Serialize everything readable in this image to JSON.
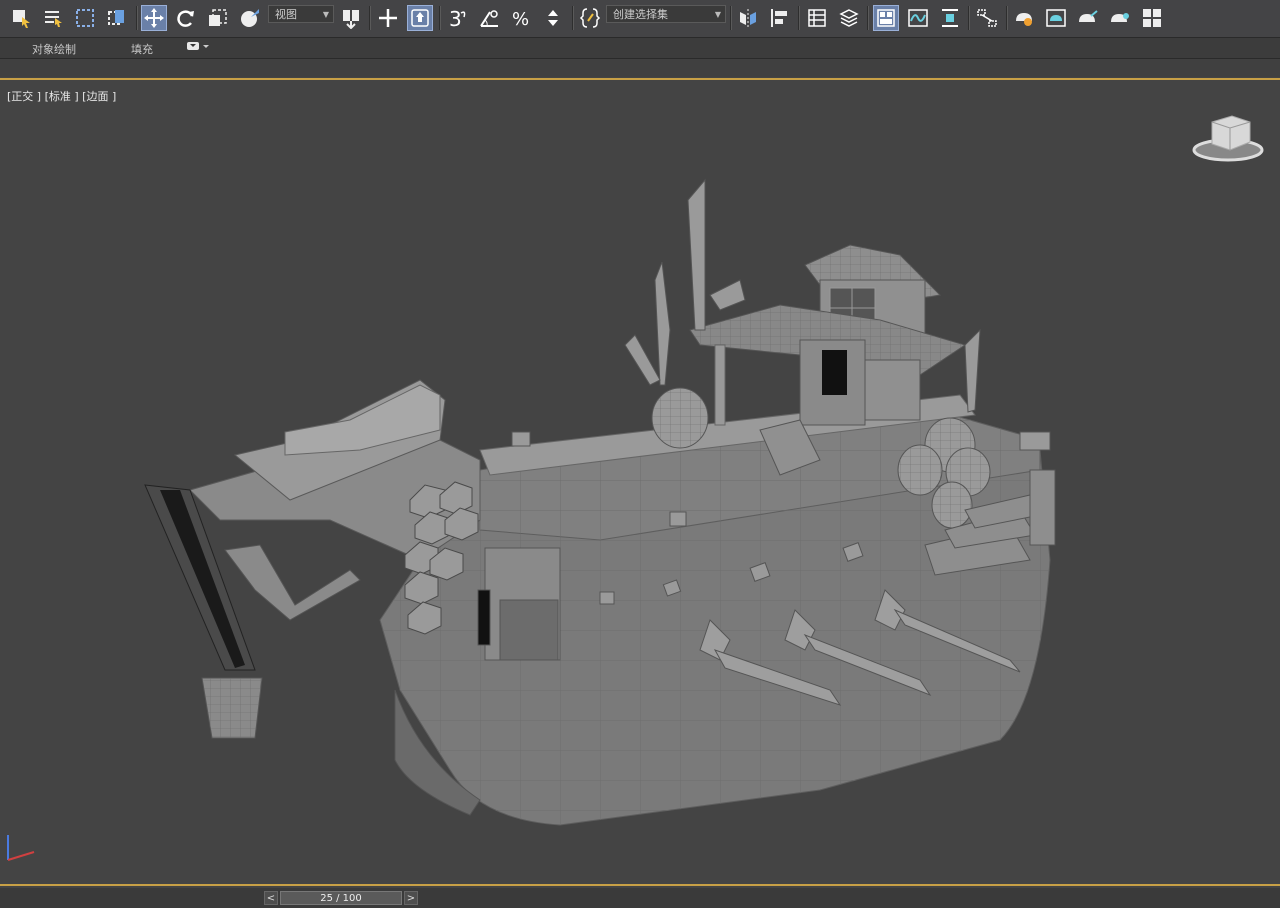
{
  "toolbar": {
    "view_dropdown": "视图",
    "selection_set_dropdown": "创建选择集",
    "snap_label": "3",
    "percent_snap_label": "%"
  },
  "ribbon": {
    "tabs": [
      "对象绘制",
      "填充"
    ]
  },
  "viewport": {
    "label": "[正交 ] [标准 ] [边面 ]",
    "border_color": "#c8a046",
    "background": "#444444"
  },
  "time_slider": {
    "prev_label": "<",
    "frame": "25 / 100",
    "next_label": ">"
  },
  "icons": [
    "select-object-icon",
    "select-by-name-icon",
    "region-select-icon",
    "window-crossing-icon",
    "move-icon",
    "rotate-icon",
    "scale-icon",
    "placement-icon",
    "mirror-dropdown-icon",
    "pivot-icon",
    "keyboard-shortcut-icon",
    "snap-3d-icon",
    "angle-snap-icon",
    "percent-snap-icon",
    "spinner-snap-icon",
    "edit-named-sets-icon",
    "mirror-icon",
    "align-icon",
    "scene-explorer-icon",
    "layer-explorer-icon",
    "ribbon-toggle-icon",
    "curve-editor-icon",
    "dope-sheet-icon",
    "schematic-view-icon",
    "material-editor-icon",
    "render-setup-icon",
    "rendered-frame-icon",
    "render-icon",
    "render-active-icon"
  ]
}
